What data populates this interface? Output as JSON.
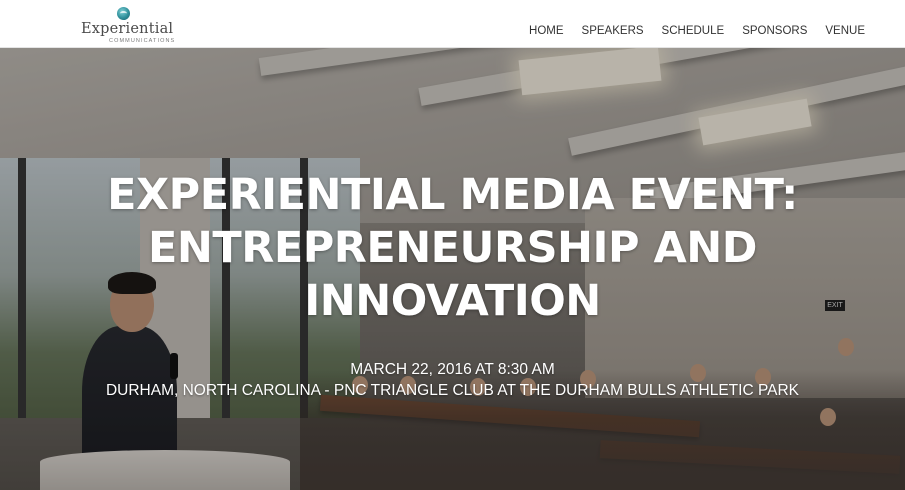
{
  "header": {
    "logo": {
      "name": "Experiential",
      "tagline": "COMMUNICATIONS"
    },
    "nav": [
      {
        "label": "HOME"
      },
      {
        "label": "SPEAKERS"
      },
      {
        "label": "SCHEDULE"
      },
      {
        "label": "SPONSORS"
      },
      {
        "label": "VENUE"
      }
    ]
  },
  "hero": {
    "title_lines": [
      "EXPERIENTIAL MEDIA EVENT:",
      "ENTREPRENEURSHIP AND",
      "INNOVATION"
    ],
    "date": "MARCH 22, 2016 AT 8:30 AM",
    "location": "DURHAM, NORTH CAROLINA - PNC TRIANGLE CLUB AT THE DURHAM BULLS ATHLETIC PARK",
    "background_image": "conference-room-photo",
    "exit_sign": "EXIT"
  },
  "colors": {
    "nav_text": "#333333",
    "hero_text": "#ffffff",
    "logo_accent": "#2f8f9a"
  }
}
